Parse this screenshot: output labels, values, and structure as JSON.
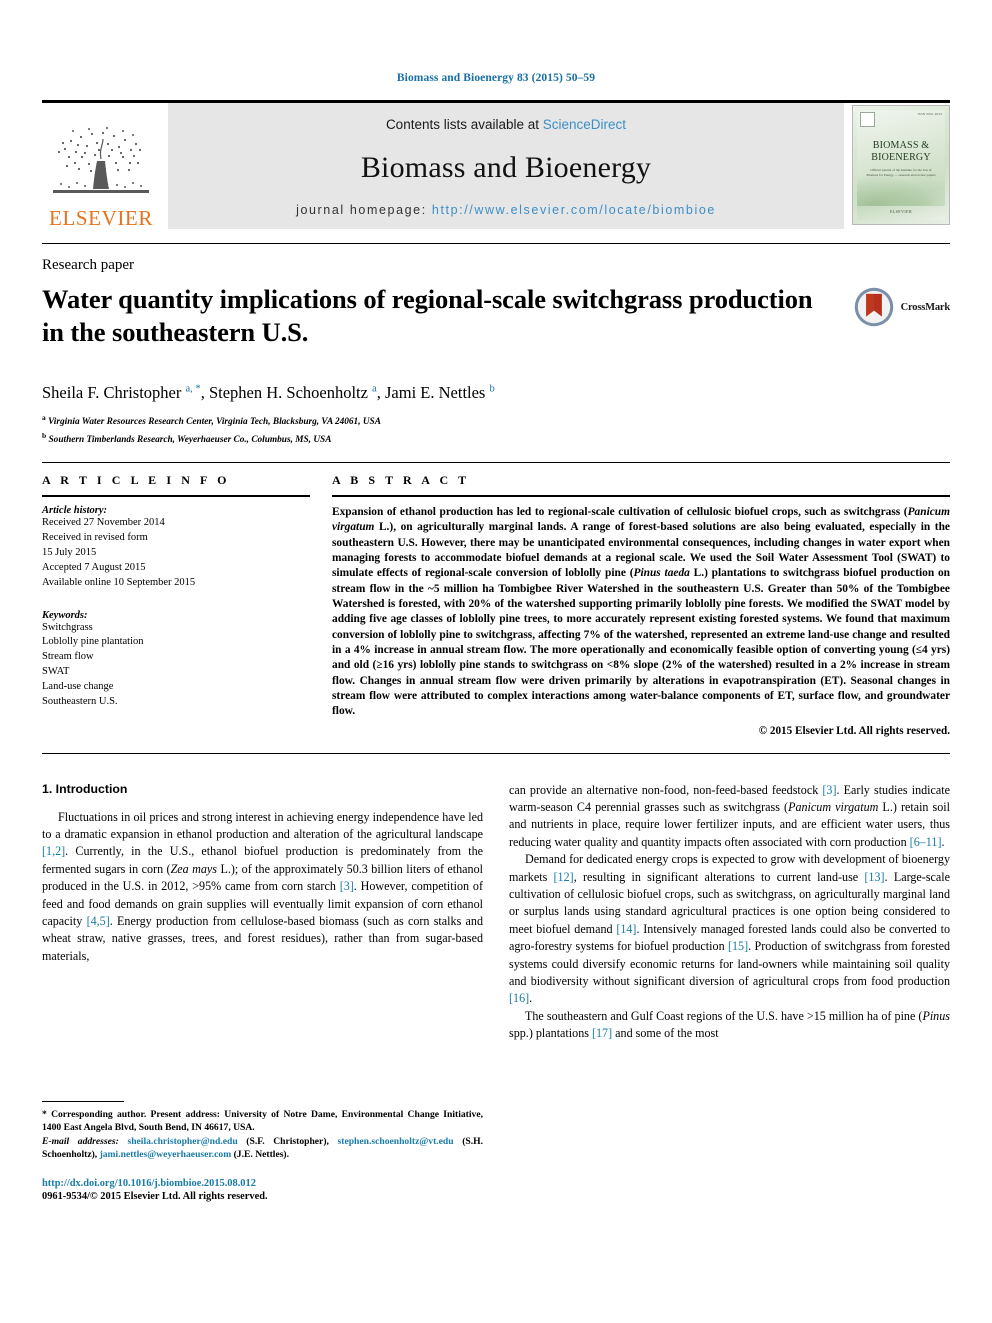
{
  "running_head": "Biomass and Bioenergy 83 (2015) 50–59",
  "masthead": {
    "publisher_logo_text": "ELSEVIER",
    "contents_prefix": "Contents lists available at ",
    "contents_link": "ScienceDirect",
    "journal_name": "Biomass and Bioenergy",
    "homepage_prefix": "journal homepage: ",
    "homepage_url": "http://www.elsevier.com/locate/biombioe",
    "cover": {
      "title_line1": "BIOMASS &",
      "title_line2": "BIOENERGY",
      "issn_text": "ISSN 0961-9534",
      "subtitle": "Official journal of the Institute for the Use of Biomass for Energy — research and review papers",
      "footer": "ELSEVIER"
    }
  },
  "article": {
    "type": "Research paper",
    "title": "Water quantity implications of regional-scale switchgrass production in the southeastern U.S.",
    "crossmark_label": "CrossMark",
    "authors_html": "Sheila F. Christopher <sup>a, *</sup>, Stephen H. Schoenholtz <sup>a</sup>, Jami E. Nettles <sup>b</sup>",
    "affiliations": [
      "Virginia Water Resources Research Center, Virginia Tech, Blacksburg, VA 24061, USA",
      "Southern Timberlands Research, Weyerhaeuser Co., Columbus, MS, USA"
    ]
  },
  "article_info": {
    "heading": "A R T I C L E  I N F O",
    "history_label": "Article history:",
    "history": [
      "Received 27 November 2014",
      "Received in revised form",
      "15 July 2015",
      "Accepted 7 August 2015",
      "Available online 10 September 2015"
    ],
    "keywords_label": "Keywords:",
    "keywords": [
      "Switchgrass",
      "Loblolly pine plantation",
      "Stream flow",
      "SWAT",
      "Land-use change",
      "Southeastern U.S."
    ]
  },
  "abstract": {
    "heading": "A B S T R A C T",
    "text_html": "Expansion of ethanol production has led to regional-scale cultivation of cellulosic biofuel crops, such as switchgrass (<i>Panicum virgatum</i> L.), on agriculturally marginal lands. A range of forest-based solutions are also being evaluated, especially in the southeastern U.S. However, there may be unanticipated environmental consequences, including changes in water export when managing forests to accommodate biofuel demands at a regional scale. We used the Soil Water Assessment Tool (SWAT) to simulate effects of regional-scale conversion of loblolly pine (<i>Pinus taeda</i> L.) plantations to switchgrass biofuel production on stream flow in the ~5 million ha Tombigbee River Watershed in the southeastern U.S. Greater than 50% of the Tombigbee Watershed is forested, with 20% of the watershed supporting primarily loblolly pine forests. We modified the SWAT model by adding five age classes of loblolly pine trees, to more accurately represent existing forested systems. We found that maximum conversion of loblolly pine to switchgrass, affecting 7% of the watershed, represented an extreme land-use change and resulted in a 4% increase in annual stream flow. The more operationally and economically feasible option of converting young (≤4 yrs) and old (≥16 yrs) loblolly pine stands to switchgrass on &lt;8% slope (2% of the watershed) resulted in a 2% increase in stream flow. Changes in annual stream flow were driven primarily by alterations in evapotranspiration (ET). Seasonal changes in stream flow were attributed to complex interactions among water-balance components of ET, surface flow, and groundwater flow.",
    "copyright": "© 2015 Elsevier Ltd. All rights reserved."
  },
  "body": {
    "section_number_title": "1.  Introduction",
    "left_paragraphs_html": [
      "Fluctuations in oil prices and strong interest in achieving energy independence have led to a dramatic expansion in ethanol production and alteration of the agricultural landscape <span class=\"ref\">[1,2]</span>. Currently, in the U.S., ethanol biofuel production is predominately from the fermented sugars in corn (<i>Zea mays</i> L.); of the approximately 50.3 billion liters of ethanol produced in the U.S. in 2012, &gt;95% came from corn starch <span class=\"ref\">[3]</span>. However, competition of feed and food demands on grain supplies will eventually limit expansion of corn ethanol capacity <span class=\"ref\">[4,5]</span>. Energy production from cellulose-based biomass (such as corn stalks and wheat straw, native grasses, trees, and forest residues), rather than from sugar-based materials,"
    ],
    "right_paragraphs_html": [
      "can provide an alternative non-food, non-feed-based feedstock <span class=\"ref\">[3]</span>. Early studies indicate warm-season C4 perennial grasses such as switchgrass (<i>Panicum virgatum</i> L.) retain soil and nutrients in place, require lower fertilizer inputs, and are efficient water users, thus reducing water quality and quantity impacts often associated with corn production <span class=\"ref\">[6–11]</span>.",
      "Demand for dedicated energy crops is expected to grow with development of bioenergy markets <span class=\"ref\">[12]</span>, resulting in significant alterations to current land-use <span class=\"ref\">[13]</span>. Large-scale cultivation of cellulosic biofuel crops, such as switchgrass, on agriculturally marginal land or surplus lands using standard agricultural practices is one option being considered to meet biofuel demand <span class=\"ref\">[14]</span>. Intensively managed forested lands could also be converted to agro-forestry systems for biofuel production <span class=\"ref\">[15]</span>. Production of switchgrass from forested systems could diversify economic returns for land-owners while maintaining soil quality and biodiversity without significant diversion of agricultural crops from food production <span class=\"ref\">[16]</span>.",
      "The southeastern and Gulf Coast regions of the U.S. have &gt;15 million ha of pine (<i>Pinus</i> spp.) plantations <span class=\"ref\">[17]</span> and some of the most"
    ]
  },
  "footnotes": {
    "corresponding_html": "<span class=\"star\">*</span> Corresponding author. Present address: University of Notre Dame, Environmental Change Initiative, 1400 East Angela Blvd, South Bend, IN 46617, USA.",
    "emails_html": "<i>E-mail addresses:</i> <span class=\"link\">sheila.christopher@nd.edu</span> (S.F. Christopher), <span class=\"link\">stephen.schoenholtz@vt.edu</span> (S.H. Schoenholtz), <span class=\"link\">jami.nettles@weyerhaeuser.com</span> (J.E. Nettles).",
    "doi": "http://dx.doi.org/10.1016/j.biombioe.2015.08.012",
    "issn_line": "0961-9534/© 2015 Elsevier Ltd. All rights reserved."
  },
  "colors": {
    "link_blue": "#1a7ba8",
    "header_blue": "#1a6fa5",
    "elsevier_orange": "#E9711C",
    "band_gray": "#e6e6e6",
    "crossmark_red": "#b5301d"
  }
}
